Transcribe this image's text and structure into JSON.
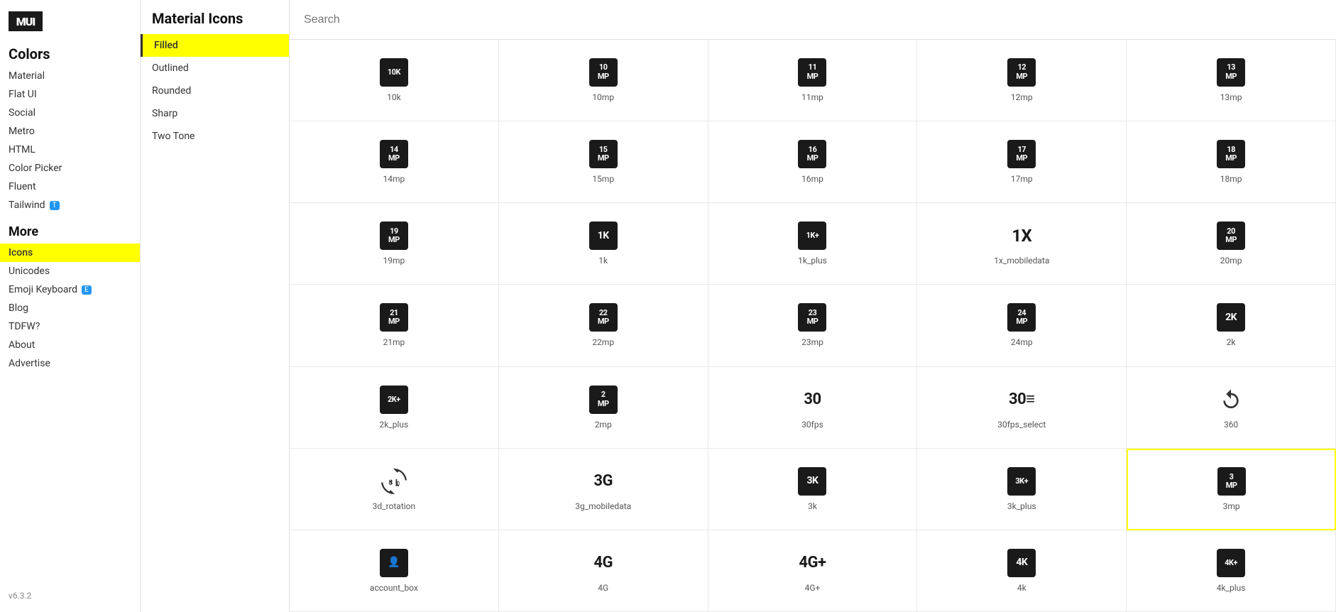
{
  "app": {
    "logo_text": "MUI",
    "version": "v6.3.2"
  },
  "sidebar": {
    "colors_title": "Colors",
    "colors_items": [
      {
        "label": "Material",
        "active": false
      },
      {
        "label": "Flat UI",
        "active": false
      },
      {
        "label": "Social",
        "active": false
      },
      {
        "label": "Metro",
        "active": false
      },
      {
        "label": "HTML",
        "active": false
      },
      {
        "label": "Color Picker",
        "active": false
      },
      {
        "label": "Fluent",
        "active": false
      },
      {
        "label": "Tailwind",
        "active": false,
        "badge": "T"
      }
    ],
    "more_title": "More",
    "more_items": [
      {
        "label": "Icons",
        "active": true
      },
      {
        "label": "Unicodes",
        "active": false
      },
      {
        "label": "Emoji Keyboard",
        "active": false,
        "badge": "E"
      },
      {
        "label": "Blog",
        "active": false
      },
      {
        "label": "TDFW?",
        "active": false
      },
      {
        "label": "About",
        "active": false
      },
      {
        "label": "Advertise",
        "active": false
      }
    ]
  },
  "middle_panel": {
    "title": "Material Icons",
    "items": [
      {
        "label": "Filled",
        "active": true
      },
      {
        "label": "Outlined",
        "active": false
      },
      {
        "label": "Rounded",
        "active": false
      },
      {
        "label": "Sharp",
        "active": false
      },
      {
        "label": "Two Tone",
        "active": false
      }
    ]
  },
  "search": {
    "placeholder": "Search"
  },
  "icons": [
    {
      "label": "10k",
      "display": "10K",
      "type": "dark"
    },
    {
      "label": "10mp",
      "display": "10\nMP",
      "type": "dark"
    },
    {
      "label": "11mp",
      "display": "11\nMP",
      "type": "dark"
    },
    {
      "label": "12mp",
      "display": "12\nMP",
      "type": "dark"
    },
    {
      "label": "13mp",
      "display": "13\nMP",
      "type": "dark"
    },
    {
      "label": "14mp",
      "display": "14\nMP",
      "type": "dark"
    },
    {
      "label": "15mp",
      "display": "15\nMP",
      "type": "dark"
    },
    {
      "label": "16mp",
      "display": "16\nMP",
      "type": "dark"
    },
    {
      "label": "17mp",
      "display": "17\nMP",
      "type": "dark"
    },
    {
      "label": "18mp",
      "display": "18\nMP",
      "type": "dark"
    },
    {
      "label": "19mp",
      "display": "19\nMP",
      "type": "dark"
    },
    {
      "label": "1k",
      "display": "1K",
      "type": "dark"
    },
    {
      "label": "1k_plus",
      "display": "1K+",
      "type": "dark"
    },
    {
      "label": "1x_mobiledata",
      "display": "1X",
      "type": "light"
    },
    {
      "label": "20mp",
      "display": "20\nMP",
      "type": "dark"
    },
    {
      "label": "21mp",
      "display": "21\nMP",
      "type": "dark"
    },
    {
      "label": "22mp",
      "display": "22\nMP",
      "type": "dark"
    },
    {
      "label": "23mp",
      "display": "23\nMP",
      "type": "dark"
    },
    {
      "label": "24mp",
      "display": "24\nMP",
      "type": "dark"
    },
    {
      "label": "2k",
      "display": "2K",
      "type": "dark"
    },
    {
      "label": "2k_plus",
      "display": "2K+",
      "type": "dark"
    },
    {
      "label": "2mp",
      "display": "2\nMP",
      "type": "dark"
    },
    {
      "label": "30fps",
      "display": "30",
      "type": "light_bold"
    },
    {
      "label": "30fps_select",
      "display": "30≡",
      "type": "light_bold"
    },
    {
      "label": "360",
      "display": "↻",
      "type": "light_arrow"
    },
    {
      "label": "3d_rotation",
      "display": "3D",
      "type": "light_3d"
    },
    {
      "label": "3g_mobiledata",
      "display": "3G",
      "type": "light_bold"
    },
    {
      "label": "3k",
      "display": "3K",
      "type": "dark"
    },
    {
      "label": "3k_plus",
      "display": "3K+",
      "type": "dark"
    },
    {
      "label": "3mp",
      "display": "3\nMP",
      "type": "dark",
      "highlighted": true
    },
    {
      "label": "account_box",
      "display": "👤",
      "type": "dark"
    },
    {
      "label": "4G",
      "display": "4G",
      "type": "light_bold"
    },
    {
      "label": "4G+",
      "display": "4G+",
      "type": "light_bold"
    },
    {
      "label": "4k",
      "display": "4K",
      "type": "dark"
    },
    {
      "label": "4k_plus",
      "display": "4K+",
      "type": "dark"
    }
  ]
}
